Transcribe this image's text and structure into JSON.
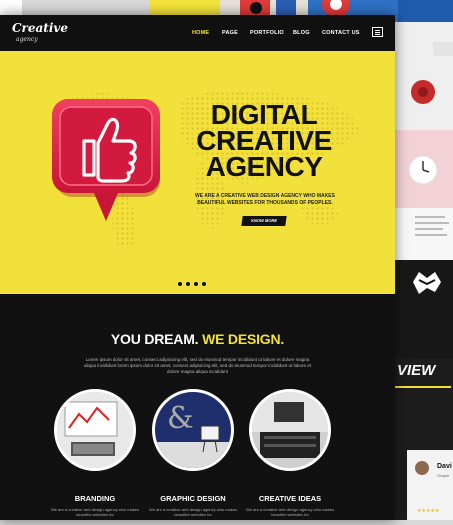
{
  "nav": {
    "logo": "Creative",
    "logo_sub": "agency",
    "items": [
      "HOME",
      "PAGE",
      "PORTFOLIO",
      "BLOG",
      "CONTACT US"
    ]
  },
  "hero": {
    "title_lines": [
      "DIGITAL",
      "CREATIVE",
      "AGENCY"
    ],
    "subtitle_line1": "WE ARE A CREATIVE WEB DESIGN AGENCY WHO MAKES",
    "subtitle_line2": "BEAUTIFUL WEBSITES FOR THOUSANDS OF PEOPLES.",
    "button": "KNOW MORE",
    "slides": 4,
    "active_slide": 1
  },
  "section": {
    "title_part1": "YOU DREAM.",
    "title_part2": "WE DESIGN.",
    "text": "Lorem ipsum dolor sit amet, consect adipisicing elit, sed do eiusmod tempor incididunt ut labore et dolore magna aliqua incididunt lorem ipsum dolor sit amet, consect adipisicing elit, sed do eiusmod tempor incididunt ut labore et dolore magna aliqua incididunt"
  },
  "features": [
    {
      "title": "BRANDING",
      "text": "We are a creative web design agency who makes beautiful websites for"
    },
    {
      "title": "GRAPHIC DESIGN",
      "text": "We are a creative web design agency who makes beautiful websites for"
    },
    {
      "title": "CREATIVE IDEAS",
      "text": "We are a creative web design agency who makes beautiful websites for"
    }
  ],
  "right_preview": {
    "heading": "VIEW",
    "name": "Davi",
    "role": "Graphi",
    "stars": "★★★★★"
  },
  "colors": {
    "accent": "#f2e13b",
    "dark": "#111111",
    "like_red": "#e8234a"
  }
}
